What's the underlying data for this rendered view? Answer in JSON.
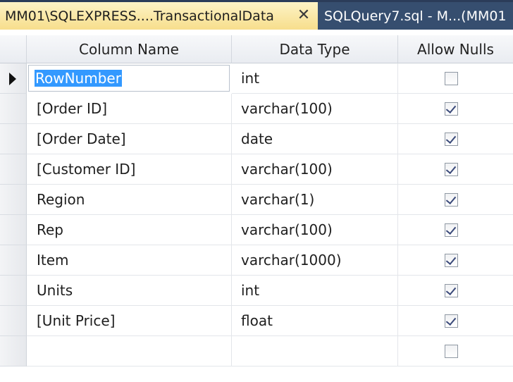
{
  "tabs": [
    {
      "label": "MM01\\SQLEXPRESS....TransactionalData",
      "active": true,
      "close_glyph": "✕"
    },
    {
      "label": "SQLQuery7.sql - M...(MM01",
      "active": false
    }
  ],
  "grid": {
    "headers": {
      "column_name": "Column Name",
      "data_type": "Data Type",
      "allow_nulls": "Allow Nulls"
    },
    "rows": [
      {
        "name": "RowNumber",
        "type": "int",
        "allow_nulls": false,
        "current": true,
        "editing": true
      },
      {
        "name": "[Order ID]",
        "type": "varchar(100)",
        "allow_nulls": true
      },
      {
        "name": "[Order Date]",
        "type": "date",
        "allow_nulls": true
      },
      {
        "name": "[Customer ID]",
        "type": "varchar(100)",
        "allow_nulls": true
      },
      {
        "name": "Region",
        "type": "varchar(1)",
        "allow_nulls": true
      },
      {
        "name": "Rep",
        "type": "varchar(100)",
        "allow_nulls": true
      },
      {
        "name": "Item",
        "type": "varchar(1000)",
        "allow_nulls": true
      },
      {
        "name": "Units",
        "type": "int",
        "allow_nulls": true
      },
      {
        "name": "[Unit Price]",
        "type": "float",
        "allow_nulls": true
      },
      {
        "name": "",
        "type": "",
        "allow_nulls": false
      }
    ]
  },
  "colors": {
    "active_tab": "#fbe9a2",
    "tab_strip": "#2b3c59",
    "selection": "#3399ff"
  }
}
